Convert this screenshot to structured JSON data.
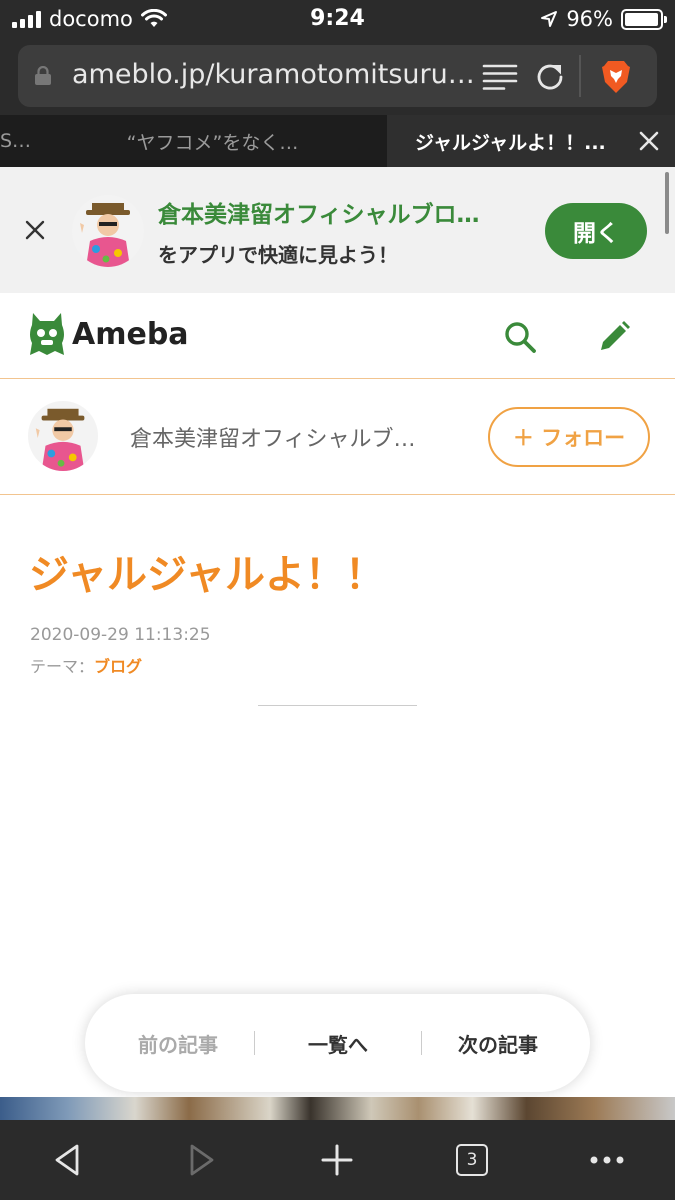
{
  "status_bar": {
    "carrier": "docomo",
    "time": "9:24",
    "battery": "96%",
    "battery_level": 0.96
  },
  "browser": {
    "url": "ameblo.jp/kuramotomitsuru/...",
    "tabs": [
      {
        "label": "S…",
        "active": false
      },
      {
        "label": "“ヤフコメ”をなく…",
        "active": false
      },
      {
        "label": "ジャルジャルよ！！...",
        "active": true
      }
    ],
    "tab_count": "3"
  },
  "app_banner": {
    "title": "倉本美津留オフィシャルブロ…",
    "subtitle": "をアプリで快適に見よう！",
    "open_label": "開く"
  },
  "header": {
    "logo_text": "Ameba",
    "brand_color": "#3a8a3a"
  },
  "blog": {
    "name": "倉本美津留オフィシャルブ…",
    "follow_label": "＋ フォロー",
    "accent_color": "#f08a24"
  },
  "article": {
    "title": "ジャルジャルよ！！",
    "date": "2020-09-29 11:13:25",
    "theme_label": "テーマ：",
    "theme": "ブログ"
  },
  "article_nav": {
    "prev": "前の記事",
    "list": "一覧へ",
    "next": "次の記事"
  }
}
